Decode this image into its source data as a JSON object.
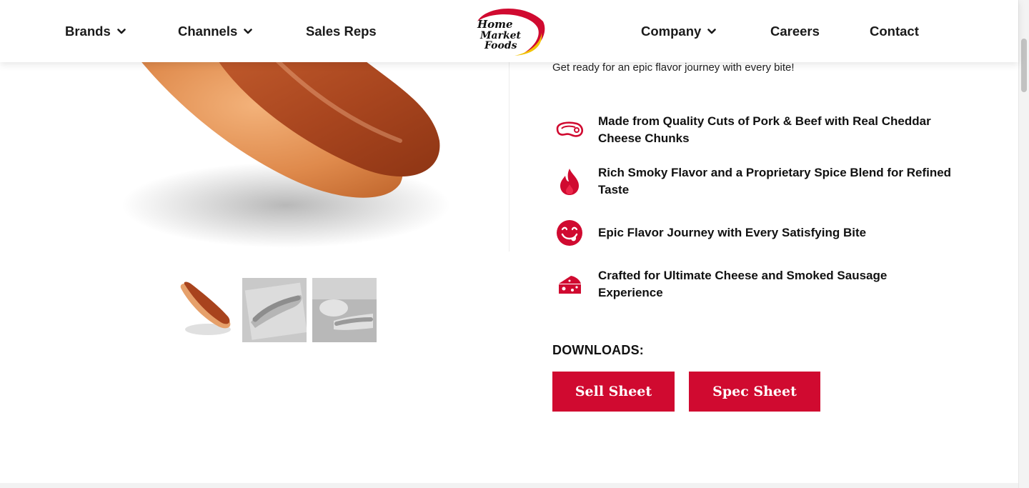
{
  "header": {
    "nav_left": [
      {
        "label": "Brands",
        "has_dropdown": true
      },
      {
        "label": "Channels",
        "has_dropdown": true
      },
      {
        "label": "Sales Reps",
        "has_dropdown": false
      }
    ],
    "logo": {
      "line1": "Home",
      "line2": "Market",
      "line3": "Foods"
    },
    "nav_right": [
      {
        "label": "Company",
        "has_dropdown": true
      },
      {
        "label": "Careers",
        "has_dropdown": false
      },
      {
        "label": "Contact",
        "has_dropdown": false
      }
    ]
  },
  "product": {
    "subtitle": "Get ready for an epic flavor journey with every bite!",
    "features": [
      {
        "icon": "steak-icon",
        "text": "Made from Quality Cuts of Pork & Beef with Real Cheddar Cheese Chunks"
      },
      {
        "icon": "flame-icon",
        "text": "Rich Smoky Flavor and a Proprietary Spice Blend for Refined Taste"
      },
      {
        "icon": "tongue-smile-icon",
        "text": "Epic Flavor Journey with Every Satisfying Bite"
      },
      {
        "icon": "cheese-icon",
        "text": "Crafted for Ultimate Cheese and Smoked Sausage Experience"
      }
    ],
    "thumbnails": [
      {
        "name": "hot-dog-thumbnail",
        "active": true
      },
      {
        "name": "hot-dog-tray-thumbnail",
        "active": false
      },
      {
        "name": "hot-dog-plate-thumbnail",
        "active": false
      }
    ]
  },
  "downloads": {
    "label": "DOWNLOADS:",
    "sell_sheet": "Sell Sheet",
    "spec_sheet": "Spec Sheet"
  },
  "colors": {
    "brand_red": "#d00a30",
    "logo_yellow": "#f2c200"
  }
}
